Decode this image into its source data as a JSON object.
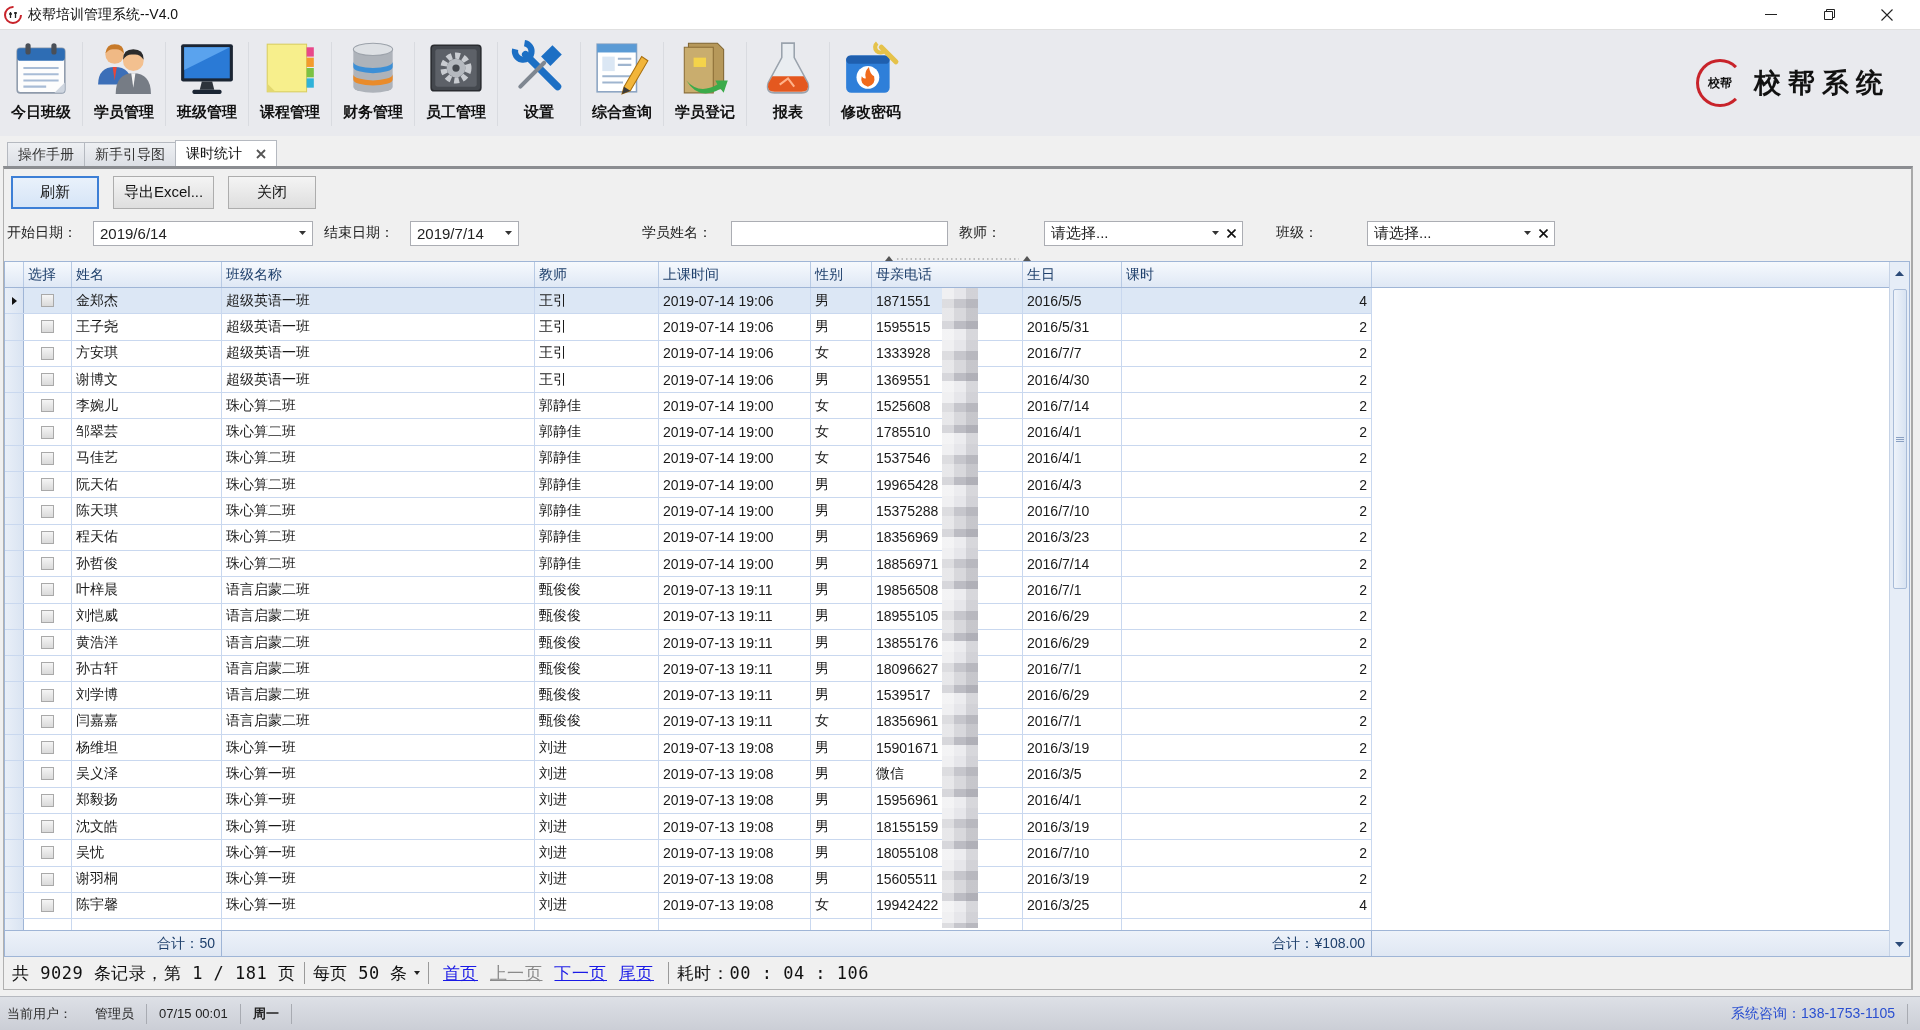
{
  "window": {
    "title": "校帮培训管理系统--V4.0"
  },
  "toolbar": {
    "buttons": [
      {
        "label": "今日班级",
        "kind": "calendar"
      },
      {
        "label": "学员管理",
        "kind": "people"
      },
      {
        "label": "班级管理",
        "kind": "monitor"
      },
      {
        "label": "课程管理",
        "kind": "notes"
      },
      {
        "label": "财务管理",
        "kind": "database"
      },
      {
        "label": "员工管理",
        "kind": "gearbox"
      },
      {
        "label": "设置",
        "kind": "tools"
      },
      {
        "label": "综合查询",
        "kind": "document"
      },
      {
        "label": "学员登记",
        "kind": "folder"
      },
      {
        "label": "报表",
        "kind": "flask"
      },
      {
        "label": "修改密码",
        "kind": "toolbox"
      }
    ],
    "logo": {
      "seal": "校帮",
      "name": "校帮系统"
    }
  },
  "tabs": [
    {
      "label": "操作手册",
      "selected": false,
      "closable": false
    },
    {
      "label": "新手引导图",
      "selected": false,
      "closable": false
    },
    {
      "label": "课时统计",
      "selected": true,
      "closable": true
    }
  ],
  "actions": [
    {
      "label": "刷新",
      "focused": true
    },
    {
      "label": "导出Excel...",
      "focused": false
    },
    {
      "label": "关闭",
      "focused": false
    }
  ],
  "filters": [
    {
      "kind": "date",
      "label": "开始日期：",
      "value": "2019/6/14"
    },
    {
      "kind": "date",
      "label": "结束日期：",
      "value": "2019/7/14"
    },
    {
      "kind": "text",
      "label": "学员姓名："
    },
    {
      "kind": "combo",
      "label": "教师：",
      "placeholder": "请选择..."
    },
    {
      "kind": "combo",
      "label": "班级：",
      "placeholder": "请选择..."
    }
  ],
  "table": {
    "select_column": "选择",
    "columns": [
      "姓名",
      "班级名称",
      "教师",
      "上课时间",
      "性别",
      "母亲电话",
      "生日",
      "课时"
    ],
    "rows": [
      {
        "selected": true,
        "checked": false,
        "cells": [
          "金郑杰",
          "超级英语一班",
          "王引",
          "2019-07-14 19:06",
          "男",
          "1871551",
          "2016/5/5",
          "4"
        ]
      },
      {
        "selected": false,
        "checked": false,
        "cells": [
          "王子尧",
          "超级英语一班",
          "王引",
          "2019-07-14 19:06",
          "男",
          "1595515",
          "2016/5/31",
          "2"
        ]
      },
      {
        "selected": false,
        "checked": false,
        "cells": [
          "方安琪",
          "超级英语一班",
          "王引",
          "2019-07-14 19:06",
          "女",
          "1333928",
          "2016/7/7",
          "2"
        ]
      },
      {
        "selected": false,
        "checked": false,
        "cells": [
          "谢博文",
          "超级英语一班",
          "王引",
          "2019-07-14 19:06",
          "男",
          "1369551",
          "2016/4/30",
          "2"
        ]
      },
      {
        "selected": false,
        "checked": false,
        "cells": [
          "李婉儿",
          "珠心算二班",
          "郭静佳",
          "2019-07-14 19:00",
          "女",
          "1525608",
          "2016/7/14",
          "2"
        ]
      },
      {
        "selected": false,
        "checked": false,
        "cells": [
          "邹翠芸",
          "珠心算二班",
          "郭静佳",
          "2019-07-14 19:00",
          "女",
          "1785510",
          "2016/4/1",
          "2"
        ]
      },
      {
        "selected": false,
        "checked": false,
        "cells": [
          "马佳艺",
          "珠心算二班",
          "郭静佳",
          "2019-07-14 19:00",
          "女",
          "1537546",
          "2016/4/1",
          "2"
        ]
      },
      {
        "selected": false,
        "checked": false,
        "cells": [
          "阮天佑",
          "珠心算二班",
          "郭静佳",
          "2019-07-14 19:00",
          "男",
          "19965428",
          "2016/4/3",
          "2"
        ]
      },
      {
        "selected": false,
        "checked": false,
        "cells": [
          "陈天琪",
          "珠心算二班",
          "郭静佳",
          "2019-07-14 19:00",
          "男",
          "15375288",
          "2016/7/10",
          "2"
        ]
      },
      {
        "selected": false,
        "checked": false,
        "cells": [
          "程天佑",
          "珠心算二班",
          "郭静佳",
          "2019-07-14 19:00",
          "男",
          "18356969",
          "2016/3/23",
          "2"
        ]
      },
      {
        "selected": false,
        "checked": false,
        "cells": [
          "孙哲俊",
          "珠心算二班",
          "郭静佳",
          "2019-07-14 19:00",
          "男",
          "18856971",
          "2016/7/14",
          "2"
        ]
      },
      {
        "selected": false,
        "checked": false,
        "cells": [
          "叶梓晨",
          "语言启蒙二班",
          "甄俊俊",
          "2019-07-13 19:11",
          "男",
          "19856508",
          "2016/7/1",
          "2"
        ]
      },
      {
        "selected": false,
        "checked": false,
        "cells": [
          "刘恺威",
          "语言启蒙二班",
          "甄俊俊",
          "2019-07-13 19:11",
          "男",
          "18955105",
          "2016/6/29",
          "2"
        ]
      },
      {
        "selected": false,
        "checked": false,
        "cells": [
          "黄浩洋",
          "语言启蒙二班",
          "甄俊俊",
          "2019-07-13 19:11",
          "男",
          "13855176",
          "2016/6/29",
          "2"
        ]
      },
      {
        "selected": false,
        "checked": false,
        "cells": [
          "孙古轩",
          "语言启蒙二班",
          "甄俊俊",
          "2019-07-13 19:11",
          "男",
          "18096627",
          "2016/7/1",
          "2"
        ]
      },
      {
        "selected": false,
        "checked": false,
        "cells": [
          "刘学博",
          "语言启蒙二班",
          "甄俊俊",
          "2019-07-13 19:11",
          "男",
          "1539517",
          "2016/6/29",
          "2"
        ]
      },
      {
        "selected": false,
        "checked": false,
        "cells": [
          "闫嘉嘉",
          "语言启蒙二班",
          "甄俊俊",
          "2019-07-13 19:11",
          "女",
          "18356961",
          "2016/7/1",
          "2"
        ]
      },
      {
        "selected": false,
        "checked": false,
        "cells": [
          "杨维坦",
          "珠心算一班",
          "刘进",
          "2019-07-13 19:08",
          "男",
          "15901671",
          "2016/3/19",
          "2"
        ]
      },
      {
        "selected": false,
        "checked": false,
        "cells": [
          "吴义泽",
          "珠心算一班",
          "刘进",
          "2019-07-13 19:08",
          "男",
          "微信",
          "2016/3/5",
          "2"
        ]
      },
      {
        "selected": false,
        "checked": false,
        "cells": [
          "郑毅扬",
          "珠心算一班",
          "刘进",
          "2019-07-13 19:08",
          "男",
          "15956961",
          "2016/4/1",
          "2"
        ]
      },
      {
        "selected": false,
        "checked": false,
        "cells": [
          "沈文皓",
          "珠心算一班",
          "刘进",
          "2019-07-13 19:08",
          "男",
          "18155159",
          "2016/3/19",
          "2"
        ]
      },
      {
        "selected": false,
        "checked": false,
        "cells": [
          "吴忧",
          "珠心算一班",
          "刘进",
          "2019-07-13 19:08",
          "男",
          "18055108",
          "2016/7/10",
          "2"
        ]
      },
      {
        "selected": false,
        "checked": false,
        "cells": [
          "谢羽桐",
          "珠心算一班",
          "刘进",
          "2019-07-13 19:08",
          "男",
          "15605511",
          "2016/3/19",
          "2"
        ]
      },
      {
        "selected": false,
        "checked": false,
        "cells": [
          "陈宇馨",
          "珠心算一班",
          "刘进",
          "2019-07-13 19:08",
          "女",
          "19942422",
          "2016/3/25",
          "4"
        ]
      }
    ],
    "footer": {
      "name_total": "合计：50",
      "hours_total": "合计：¥108.00"
    }
  },
  "pager": {
    "summary": "共 9029 条记录，第 1 / 181 页",
    "page_size": "每页 50 条",
    "links": [
      {
        "label": "首页",
        "disabled": false
      },
      {
        "label": "上一页",
        "disabled": true
      },
      {
        "label": "下一页",
        "disabled": false
      },
      {
        "label": "尾页",
        "disabled": false
      }
    ],
    "elapsed": "耗时：00 : 04 : 106"
  },
  "status_bar": {
    "user_label": "当前用户：",
    "user": "管理员",
    "datetime": "07/15 00:01",
    "weekday": "周一",
    "hotline": "系统咨询：138-1753-1105"
  }
}
